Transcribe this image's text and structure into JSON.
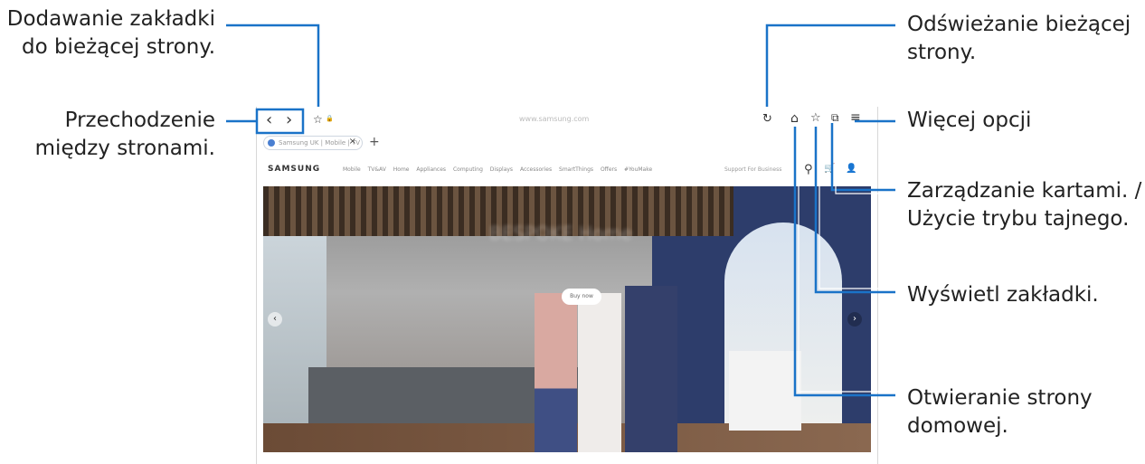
{
  "callouts": {
    "bookmark_add": "Dodawanie zakładki\ndo bieżącej strony.",
    "navigate": "Przechodzenie\nmiędzy stronami.",
    "refresh": "Odświeżanie bieżącej\nstrony.",
    "more": "Więcej opcji",
    "tabs": "Zarządzanie kartami. /\nUżycie trybu tajnego.",
    "bookmarks": "Wyświetl zakładki.",
    "home": "Otwieranie strony\ndomowej."
  },
  "browser": {
    "url": "www.samsung.com",
    "tab_label": "Samsung UK | Mobile | TV",
    "new_tab": "+",
    "tab_close": "×"
  },
  "site": {
    "logo": "SAMSUNG",
    "nav_links": "Mobile TV&AV Home Appliances Computing Displays Accessories SmartThings Offers #YouMake",
    "nav_right": "Support  For Business",
    "hero_title": "BESPOKE Home",
    "shop_button": "Buy now"
  },
  "icons": {
    "back": "‹",
    "forward": "›",
    "bookmark_star": "☆",
    "lock": "🔒",
    "refresh": "↻",
    "home": "⌂",
    "bookmarks": "☆",
    "tabs": "⧉",
    "menu": "≡",
    "search": "⚲",
    "cart": "🛒",
    "user": "👤",
    "slide_prev": "‹",
    "slide_next": "›"
  },
  "colors": {
    "callout_line": "#1a73c8"
  }
}
